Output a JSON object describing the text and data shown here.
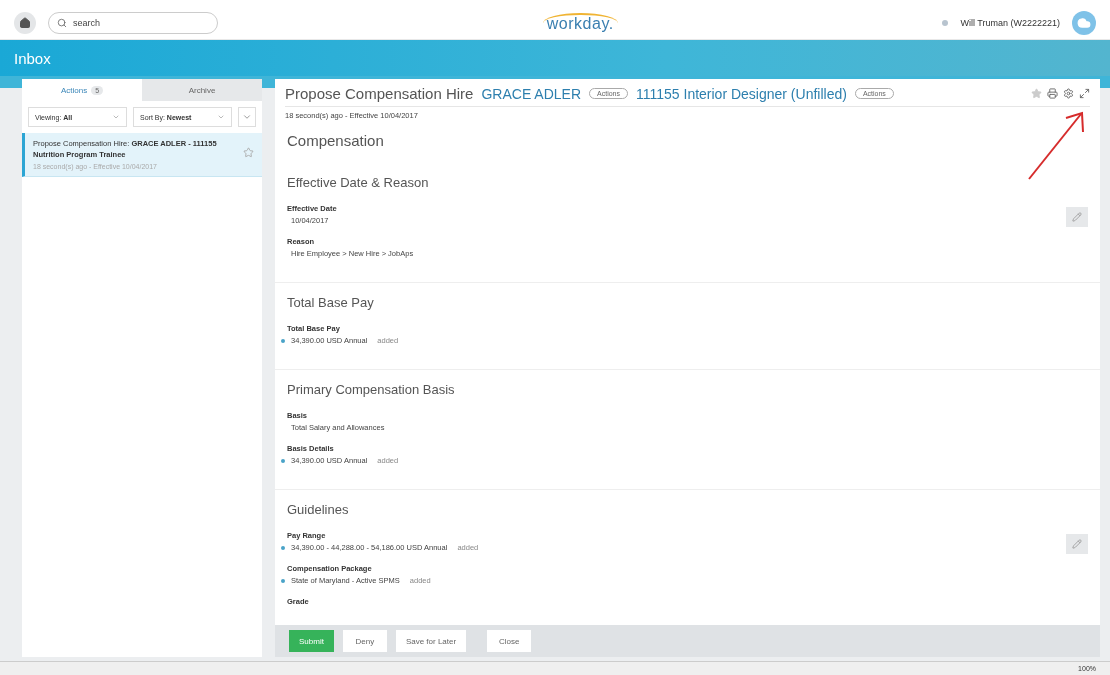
{
  "topbar": {
    "search_placeholder": "search",
    "logo": "workday.",
    "user": "Will Truman (W2222221)"
  },
  "header": {
    "title": "Inbox"
  },
  "inbox": {
    "tabs": [
      {
        "label": "Actions",
        "count": "5",
        "selected": true
      },
      {
        "label": "Archive",
        "selected": false
      }
    ],
    "filters": [
      {
        "label": "Viewing:",
        "value": "All"
      },
      {
        "label": "Sort By:",
        "value": "Newest"
      }
    ],
    "items": [
      {
        "title_plain": "Propose Compensation Hire: ",
        "title_bold": "GRACE ADLER - 111155 Nutrition Program Trainee",
        "meta": "18 second(s) ago - Effective 10/04/2017",
        "selected": true
      }
    ]
  },
  "detail": {
    "title": "Propose Compensation Hire",
    "links": [
      {
        "text": "GRACE ADLER",
        "action": "Actions"
      },
      {
        "text": "111155 Interior Designer (Unfilled)",
        "action": "Actions"
      }
    ],
    "meta": "18 second(s) ago - Effective 10/04/2017",
    "heading": "Compensation",
    "sections": [
      {
        "title": "Effective Date & Reason",
        "editable": true,
        "fields": [
          {
            "label": "Effective Date",
            "value": "10/04/2017"
          },
          {
            "label": "Reason",
            "value": "Hire Employee > New Hire > JobAps"
          }
        ]
      },
      {
        "title": "Total Base Pay",
        "editable": false,
        "fields": [
          {
            "label": "Total Base Pay",
            "value": "34,390.00 USD Annual",
            "added": true,
            "note": "added"
          }
        ]
      },
      {
        "title": "Primary Compensation Basis",
        "editable": false,
        "fields": [
          {
            "label": "Basis",
            "value": "Total Salary and Allowances"
          },
          {
            "label": "Basis Details",
            "value": "34,390.00 USD Annual",
            "added": true,
            "note": "added"
          }
        ]
      },
      {
        "title": "Guidelines",
        "editable": true,
        "fields": [
          {
            "label": "Pay Range",
            "value": "34,390.00 - 44,288.00 - 54,186.00 USD Annual",
            "added": true,
            "note": "added"
          },
          {
            "label": "Compensation Package",
            "value": "State of Maryland - Active SPMS",
            "added": true,
            "note": "added"
          },
          {
            "label": "Grade"
          }
        ]
      }
    ],
    "buttons": [
      {
        "label": "Submit",
        "kind": "primary"
      },
      {
        "label": "Deny",
        "kind": "plain"
      },
      {
        "label": "Save for Later",
        "kind": "plain"
      },
      {
        "label": "Close",
        "kind": "separated"
      }
    ]
  },
  "status_bar": {
    "zoom": "100%"
  }
}
